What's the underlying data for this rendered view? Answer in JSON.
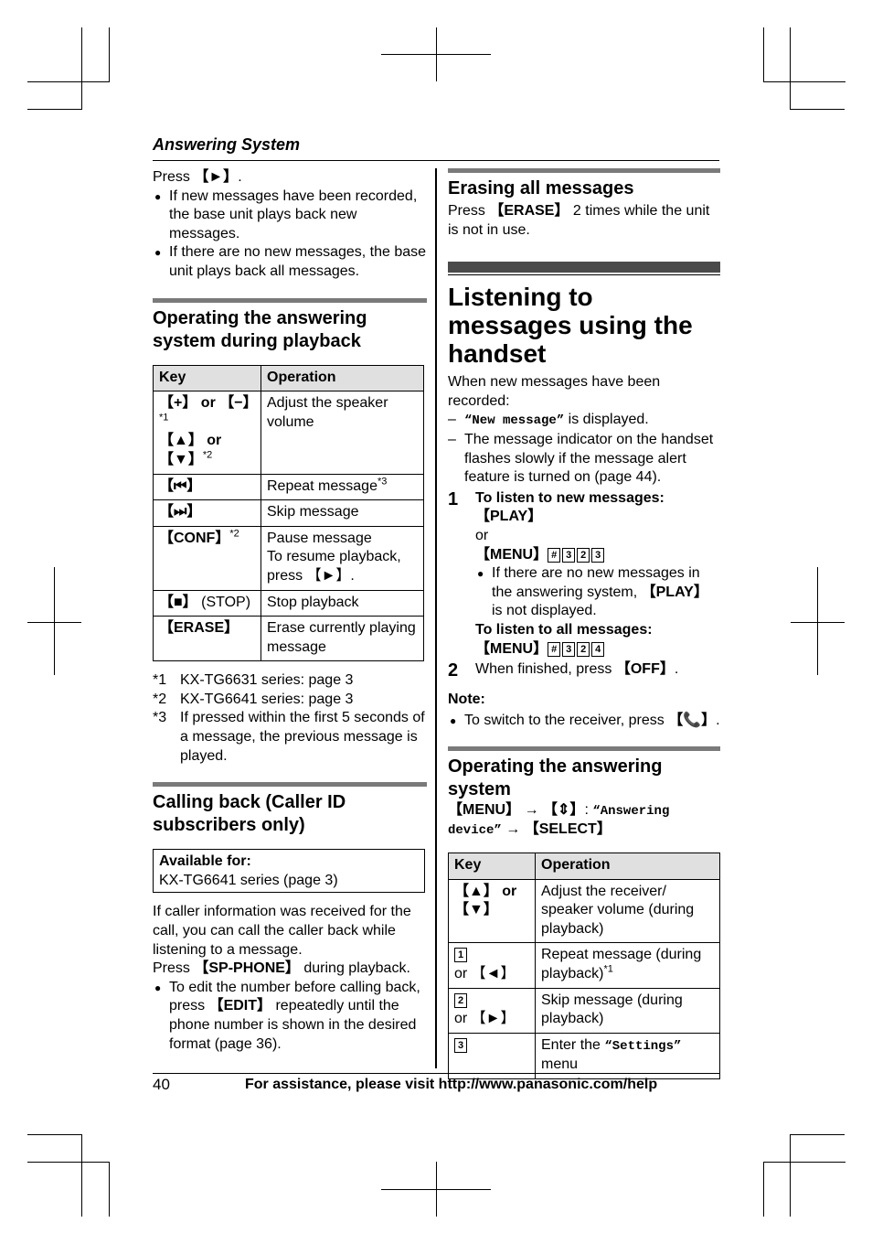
{
  "header": {
    "section_title": "Answering System"
  },
  "left": {
    "intro": {
      "press_prefix": "Press ",
      "press_key": "【►】",
      "press_suffix": ".",
      "bullets": [
        "If new messages have been recorded, the base unit plays back new messages.",
        "If there are no new messages, the base unit plays back all messages."
      ]
    },
    "playback_section": {
      "title": "Operating the answering system during playback",
      "table": {
        "headers": [
          "Key",
          "Operation"
        ],
        "rows": [
          {
            "key": "【+】 or 【−】",
            "key_sup": "*1",
            "key2": "【▲】 or 【▼】",
            "key2_sup": "*2",
            "operation": "Adjust the speaker volume",
            "op_sup": ""
          },
          {
            "key": "【⏮】",
            "key_sup": "",
            "operation": "Repeat message",
            "op_sup": "*3"
          },
          {
            "key": "【⏭】",
            "key_sup": "",
            "operation": "Skip message",
            "op_sup": ""
          },
          {
            "key": "【CONF】",
            "key_sup": "*2",
            "operation": "Pause message",
            "operation2": "To resume playback, press 【►】.",
            "op_sup": ""
          },
          {
            "key": "【■】",
            "key_suffix": " (STOP)",
            "key_sup": "",
            "operation": "Stop playback",
            "op_sup": ""
          },
          {
            "key": "【ERASE】",
            "key_sup": "",
            "operation": "Erase currently playing message",
            "op_sup": ""
          }
        ]
      },
      "footnotes": [
        {
          "mark": "*1",
          "text": "KX-TG6631 series: page 3"
        },
        {
          "mark": "*2",
          "text": "KX-TG6641 series: page 3"
        },
        {
          "mark": "*3",
          "text": "If pressed within the first 5 seconds of a message, the previous message is played."
        }
      ]
    },
    "callback_section": {
      "title": "Calling back (Caller ID subscribers only)",
      "available_label": "Available for:",
      "available_value": "KX-TG6641 series (page 3)",
      "paragraph": "If caller information was received for the call, you can call the caller back while listening to a message.",
      "press_prefix": "Press ",
      "press_key": "【SP-PHONE】",
      "press_suffix": " during playback.",
      "bullet_prefix": "To edit the number before calling back, press ",
      "bullet_key": "【EDIT】",
      "bullet_suffix": " repeatedly until the phone number is shown in the desired format (page 36)."
    }
  },
  "right": {
    "erase_section": {
      "title": "Erasing all messages",
      "prefix": "Press ",
      "key": "【ERASE】",
      "suffix": " 2 times while the unit is not in use."
    },
    "handset_section": {
      "title": "Listening to messages using the handset",
      "intro": "When new messages have been recorded:",
      "dash1_quote": "“New message”",
      "dash1_suffix": " is displayed.",
      "dash2": "The message indicator on the handset flashes slowly if the message alert feature is turned on (page 44).",
      "step1_number": "1",
      "step1_title": "To listen to new messages:",
      "step1_key": "【PLAY】",
      "step1_or": "or",
      "step1_menu": "【MENU】",
      "step1_digits": [
        "#",
        "3",
        "2",
        "3"
      ],
      "step1_bullet_prefix": "If there are no new messages in the answering system, ",
      "step1_bullet_key": "【PLAY】",
      "step1_bullet_suffix": " is not displayed.",
      "step1_all_title": "To listen to all messages:",
      "step1_all_menu": "【MENU】",
      "step1_all_digits": [
        "#",
        "3",
        "2",
        "4"
      ],
      "step2_number": "2",
      "step2_prefix": "When finished, press ",
      "step2_key": "【OFF】",
      "step2_suffix": ".",
      "note_label": "Note:",
      "note_prefix": "To switch to the receiver, press ",
      "note_key": "【📞】",
      "note_suffix": "."
    },
    "answering_section": {
      "title": "Operating the answering system",
      "nav_menu": "【MENU】",
      "nav_arrow1": " → ",
      "nav_updown": "【⇕】",
      "nav_colon": ": ",
      "nav_quote": "“Answering device”",
      "nav_arrow2": " → ",
      "nav_select": "【SELECT】",
      "table": {
        "headers": [
          "Key",
          "Operation"
        ],
        "rows": [
          {
            "key": "【▲】 or 【▼】",
            "operation": "Adjust the receiver/ speaker volume (during playback)",
            "op_sup": ""
          },
          {
            "digit": "1",
            "key": " or 【◄】",
            "operation": "Repeat message (during playback)",
            "op_sup": "*1"
          },
          {
            "digit": "2",
            "key": " or 【►】",
            "operation": "Skip message (during playback)",
            "op_sup": ""
          },
          {
            "digit": "3",
            "key": "",
            "operation_prefix": "Enter the ",
            "operation_quote": "“Settings”",
            "operation": " menu",
            "op_sup": ""
          }
        ]
      }
    }
  },
  "footer": {
    "page_number": "40",
    "assistance": "For assistance, please visit http://www.panasonic.com/help"
  }
}
